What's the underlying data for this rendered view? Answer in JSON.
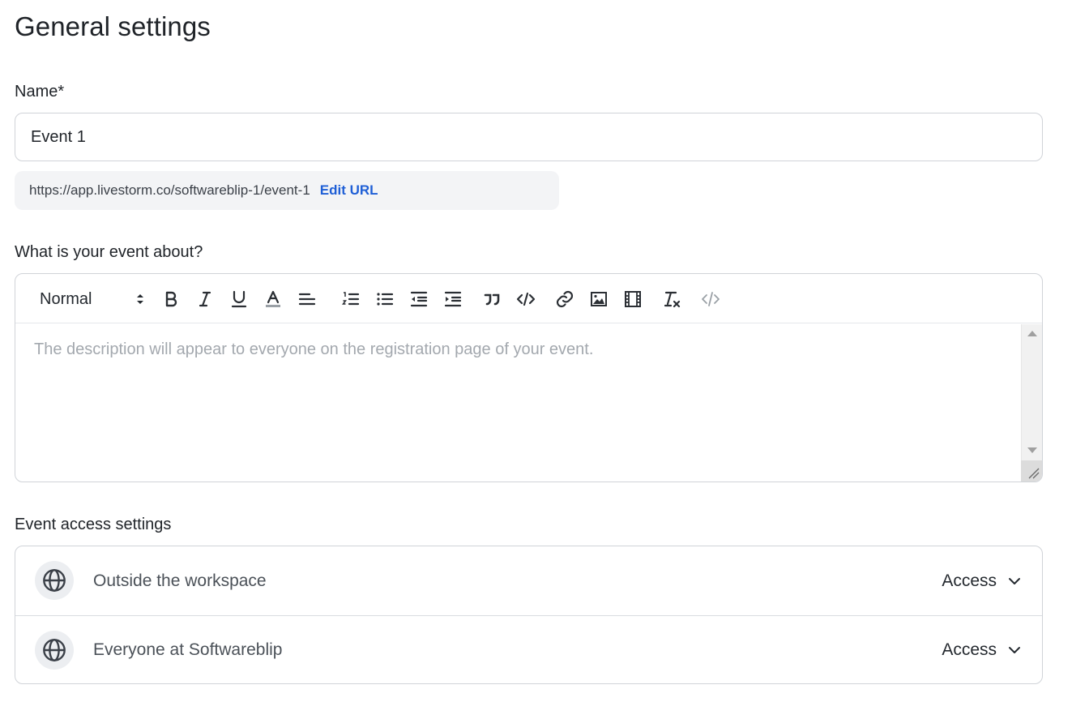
{
  "page": {
    "title": "General settings"
  },
  "name_field": {
    "label": "Name*",
    "value": "Event 1"
  },
  "url": {
    "text": "https://app.livestorm.co/softwareblip-1/event-1",
    "edit_label": "Edit URL"
  },
  "description": {
    "label": "What is your event about?",
    "format_value": "Normal",
    "placeholder": "The description will appear to everyone on the registration page of your event.",
    "toolbar_icons": [
      "bold-icon",
      "italic-icon",
      "underline-icon",
      "text-color-icon",
      "align-left-icon",
      "ordered-list-icon",
      "bullet-list-icon",
      "outdent-icon",
      "indent-icon",
      "blockquote-icon",
      "code-icon",
      "link-icon",
      "image-icon",
      "video-icon",
      "clear-format-icon",
      "source-code-icon"
    ]
  },
  "access": {
    "label": "Event access settings",
    "rows": [
      {
        "label": "Outside the workspace",
        "value": "Access",
        "icon": "globe-icon"
      },
      {
        "label": "Everyone at Softwareblip",
        "value": "Access",
        "icon": "globe-icon"
      }
    ]
  },
  "colors": {
    "link": "#1f5fd6",
    "border": "#d0d3d8",
    "placeholder": "#a3a8ae"
  }
}
